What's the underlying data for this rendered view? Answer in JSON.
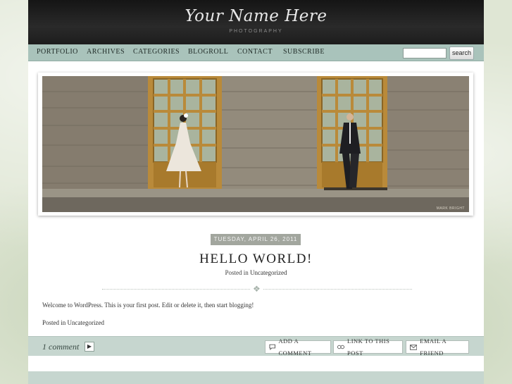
{
  "header": {
    "logo_script": "Your Name Here",
    "logo_subtitle": "PHOTOGRAPHY"
  },
  "nav": {
    "items": [
      "PORTFOLIO",
      "ARCHIVES",
      "CATEGORIES",
      "BLOGROLL",
      "CONTACT",
      "SUBSCRIBE"
    ],
    "search_value": "",
    "search_button": "search"
  },
  "hero": {
    "copyright": "MARK BRIGHT"
  },
  "post": {
    "date": "TUESDAY, APRIL 26, 2011",
    "title": "HELLO WORLD!",
    "posted_in_prefix": "Posted in",
    "category": "Uncategorized",
    "body": "Welcome to WordPress. This is your first post. Edit or delete it, then start blogging!"
  },
  "comments": {
    "count_label": "1 comment",
    "arrow": "▶",
    "add_comment": "ADD A COMMENT",
    "link_to_post": "LINK TO THIS POST",
    "email_friend": "EMAIL A FRIEND"
  },
  "colors": {
    "header_bg": "#1d1d1d",
    "nav_bg": "#a9c3bb",
    "comment_bar_bg": "#c6d6cf",
    "date_badge_bg": "#a2a69e"
  }
}
